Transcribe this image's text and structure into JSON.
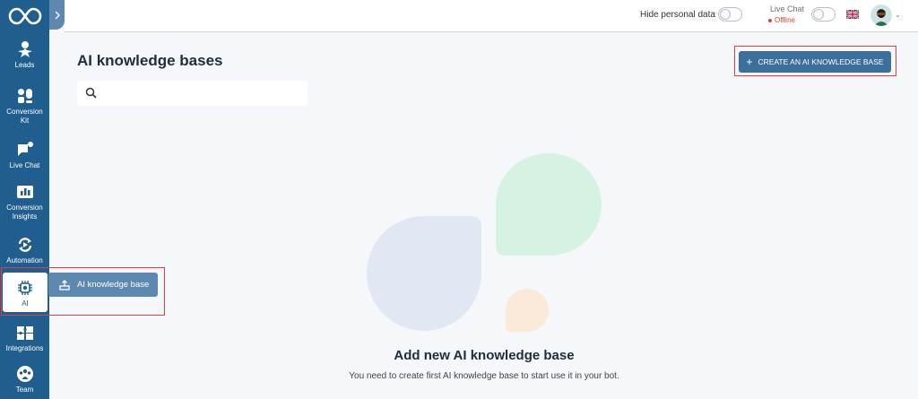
{
  "sidebar": {
    "items": [
      {
        "label": "Leads",
        "icon": "leads-icon"
      },
      {
        "label": "Conversion Kit",
        "icon": "conversion-kit-icon"
      },
      {
        "label": "Live Chat",
        "icon": "live-chat-icon"
      },
      {
        "label": "Conversion Insights",
        "icon": "insights-icon"
      },
      {
        "label": "Automation",
        "icon": "automation-icon"
      },
      {
        "label": "AI",
        "icon": "ai-chip-icon",
        "active": true
      },
      {
        "label": "Integrations",
        "icon": "integrations-icon"
      },
      {
        "label": "Team",
        "icon": "team-icon"
      }
    ],
    "submenu": {
      "label": "AI knowledge base",
      "icon": "knowledge-base-icon"
    }
  },
  "topbar": {
    "hide_personal_data_label": "Hide personal data",
    "live_chat_label": "Live Chat",
    "live_chat_status": "Offline",
    "status_color": "#e0413a"
  },
  "main": {
    "title": "AI knowledge bases",
    "search": {
      "placeholder": "",
      "value": ""
    },
    "create_button_label": "CREATE AN AI KNOWLEDGE BASE",
    "empty_state": {
      "title": "Add new AI knowledge base",
      "text": "You need to create first AI knowledge base to start use it in your bot."
    }
  },
  "colors": {
    "sidebar": "#1f5e8e",
    "accent": "#3d6f9d",
    "highlight": "#e0413a"
  }
}
